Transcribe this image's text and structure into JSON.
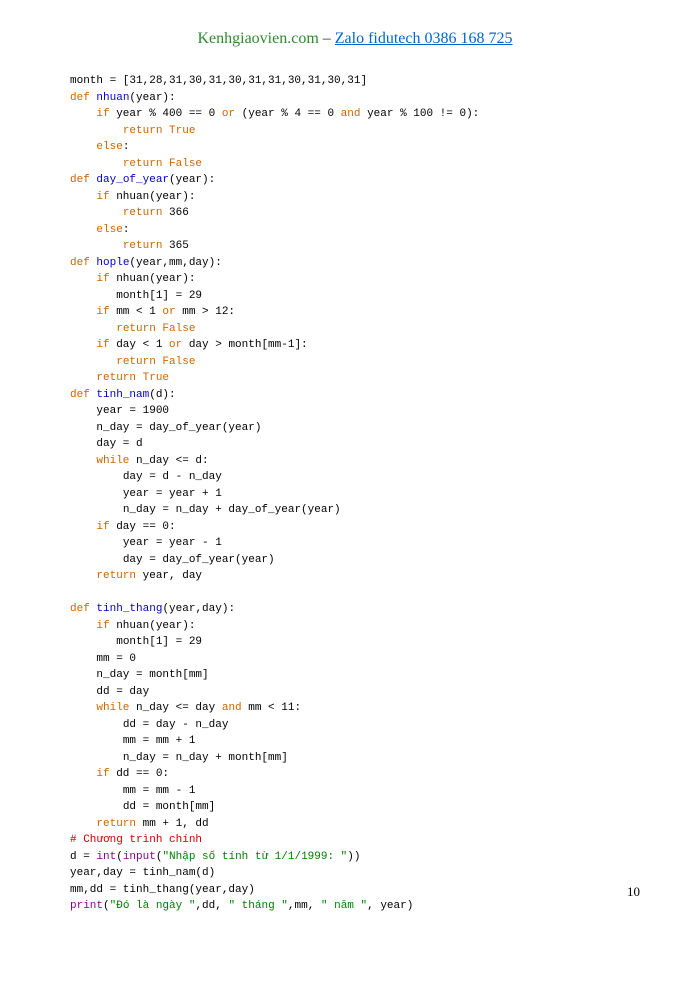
{
  "header": {
    "site": "Kenhgiaovien.com",
    "dash": " – ",
    "link": "Zalo fidutech 0386 168 725"
  },
  "page_number": "10",
  "code": {
    "l1_a": "month = [31,28,31,30,31,30,31,31,30,31,30,31]",
    "l2_def": "def",
    "l2_name": " nhuan",
    "l2_rest": "(year):",
    "l3_if": "if",
    "l3_a": " year % 400 == 0 ",
    "l3_or": "or",
    "l3_b": " (year % 4 == 0 ",
    "l3_and": "and",
    "l3_c": " year % 100 != 0):",
    "l4_ret": "return",
    "l4_true": " True",
    "l5_else": "else",
    "l5_colon": ":",
    "l6_ret": "return",
    "l6_false": " False",
    "l7_def": "def",
    "l7_name": " day_of_year",
    "l7_rest": "(year):",
    "l8_if": "if",
    "l8_a": " nhuan(year):",
    "l9_ret": "return",
    "l9_v": " 366",
    "l10_else": "else",
    "l10_colon": ":",
    "l11_ret": "return",
    "l11_v": " 365",
    "l12_def": "def",
    "l12_name": " hople",
    "l12_rest": "(year,mm,day):",
    "l13_if": "if",
    "l13_a": " nhuan(year):",
    "l14": "month[1] = 29",
    "l15_if": "if",
    "l15_a": " mm < 1 ",
    "l15_or": "or",
    "l15_b": " mm > 12:",
    "l16_ret": "return",
    "l16_false": " False",
    "l17_if": "if",
    "l17_a": " day < 1 ",
    "l17_or": "or",
    "l17_b": " day > month[mm-1]:",
    "l18_ret": "return",
    "l18_false": " False",
    "l19_ret": "return",
    "l19_true": " True",
    "l20_def": "def",
    "l20_name": " tinh_nam",
    "l20_rest": "(d):",
    "l21": "year = 1900",
    "l22": "n_day = day_of_year(year)",
    "l23": "day = d",
    "l24_while": "while",
    "l24_a": " n_day <= d:",
    "l25": "day = d - n_day",
    "l26": "year = year + 1",
    "l27": "n_day = n_day + day_of_year(year)",
    "l28_if": "if",
    "l28_a": " day == 0:",
    "l29": "year = year - 1",
    "l30": "day = day_of_year(year)",
    "l31_ret": "return",
    "l31_a": " year, day",
    "l32_def": "def",
    "l32_name": " tinh_thang",
    "l32_rest": "(year,day):",
    "l33_if": "if",
    "l33_a": " nhuan(year):",
    "l34": "month[1] = 29",
    "l35": "mm = 0",
    "l36": "n_day = month[mm]",
    "l37": "dd = day",
    "l38_while": "while",
    "l38_a": " n_day <= day ",
    "l38_and": "and",
    "l38_b": " mm < 11:",
    "l39": "dd = day - n_day",
    "l40": "mm = mm + 1",
    "l41": "n_day = n_day + month[mm]",
    "l42_if": "if",
    "l42_a": " dd == 0:",
    "l43": "mm = mm - 1",
    "l44": "dd = month[mm]",
    "l45_ret": "return",
    "l45_a": " mm + 1, dd",
    "l46": "# Chương trình chính",
    "l47_a": "d = ",
    "l47_int": "int",
    "l47_b": "(",
    "l47_input": "input",
    "l47_c": "(",
    "l47_str": "\"Nhập số tính từ 1/1/1999: \"",
    "l47_d": "))",
    "l48": "year,day = tinh_nam(d)",
    "l49": "mm,dd = tinh_thang(year,day)",
    "l50_print": "print",
    "l50_a": "(",
    "l50_s1": "\"Đó là ngày \"",
    "l50_b": ",dd, ",
    "l50_s2": "\" tháng \"",
    "l50_c": ",mm, ",
    "l50_s3": "\" năm \"",
    "l50_d": ", year)"
  }
}
